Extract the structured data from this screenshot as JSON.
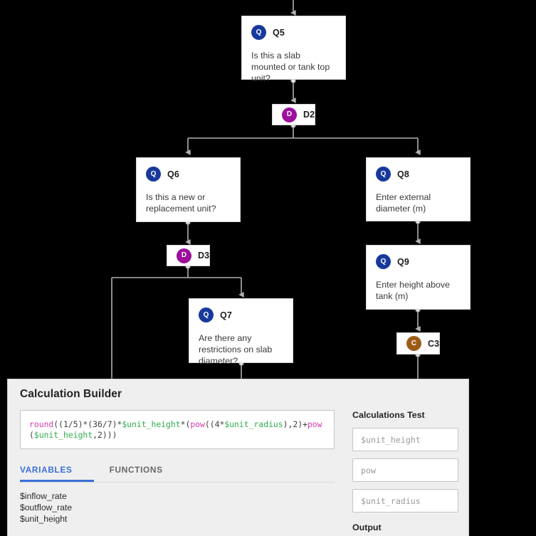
{
  "flow": {
    "nodes": [
      {
        "id": "q5",
        "code": "Q5",
        "kind": "Q",
        "kind_letter": "Q",
        "text": "Is this a slab mounted or tank top unit?"
      },
      {
        "id": "d2",
        "code": "D2",
        "kind": "D",
        "kind_letter": "D",
        "text": ""
      },
      {
        "id": "q6",
        "code": "Q6",
        "kind": "Q",
        "kind_letter": "Q",
        "text": "Is this a new or replacement unit?"
      },
      {
        "id": "q8",
        "code": "Q8",
        "kind": "Q",
        "kind_letter": "Q",
        "text": "Enter external diameter (m)"
      },
      {
        "id": "d3",
        "code": "D3",
        "kind": "D",
        "kind_letter": "D",
        "text": ""
      },
      {
        "id": "q9",
        "code": "Q9",
        "kind": "Q",
        "kind_letter": "Q",
        "text": "Enter height above tank (m)"
      },
      {
        "id": "q7",
        "code": "Q7",
        "kind": "Q",
        "kind_letter": "Q",
        "text": "Are there any restrictions on slab diameter?"
      },
      {
        "id": "c3",
        "code": "C3",
        "kind": "C",
        "kind_letter": "C",
        "text": ""
      }
    ],
    "colors": {
      "question_badge": "#17399c",
      "decision_badge": "#9c0f9c",
      "calculation_badge": "#9c5c17",
      "connector": "#b0b0b0",
      "canvas_background": "#000000"
    }
  },
  "panel": {
    "title": "Calculation Builder",
    "formula": {
      "raw": "round((1/5)*(36/7)*$unit_height*(pow((4*$unit_radius),2)+pow($unit_height,2)))",
      "tokens": [
        {
          "t": "round",
          "c": "fn"
        },
        {
          "t": "((1/5)*(36/7)*",
          "c": "plain"
        },
        {
          "t": "$unit_height",
          "c": "var"
        },
        {
          "t": "*(",
          "c": "plain"
        },
        {
          "t": "pow",
          "c": "fn"
        },
        {
          "t": "((4*",
          "c": "plain"
        },
        {
          "t": "$unit_radius",
          "c": "var"
        },
        {
          "t": "),2)+",
          "c": "plain"
        },
        {
          "t": "pow",
          "c": "fn"
        },
        {
          "t": "(",
          "c": "plain"
        },
        {
          "t": "$unit_height",
          "c": "var"
        },
        {
          "t": ",2)))",
          "c": "plain"
        }
      ],
      "function_color": "#d43bb0",
      "variable_color": "#2fae4f"
    },
    "tabs": [
      {
        "label": "VARIABLES",
        "active": true
      },
      {
        "label": "FUNCTIONS",
        "active": false
      }
    ],
    "variables": [
      "$inflow_rate",
      "$outflow_rate",
      "$unit_height"
    ],
    "test": {
      "title": "Calculations Test",
      "inputs": [
        {
          "value": "",
          "placeholder": "$unit_height"
        },
        {
          "value": "",
          "placeholder": "pow"
        },
        {
          "value": "",
          "placeholder": "$unit_radius"
        }
      ],
      "output_label": "Output"
    },
    "accent_color": "#3a6fd8"
  }
}
